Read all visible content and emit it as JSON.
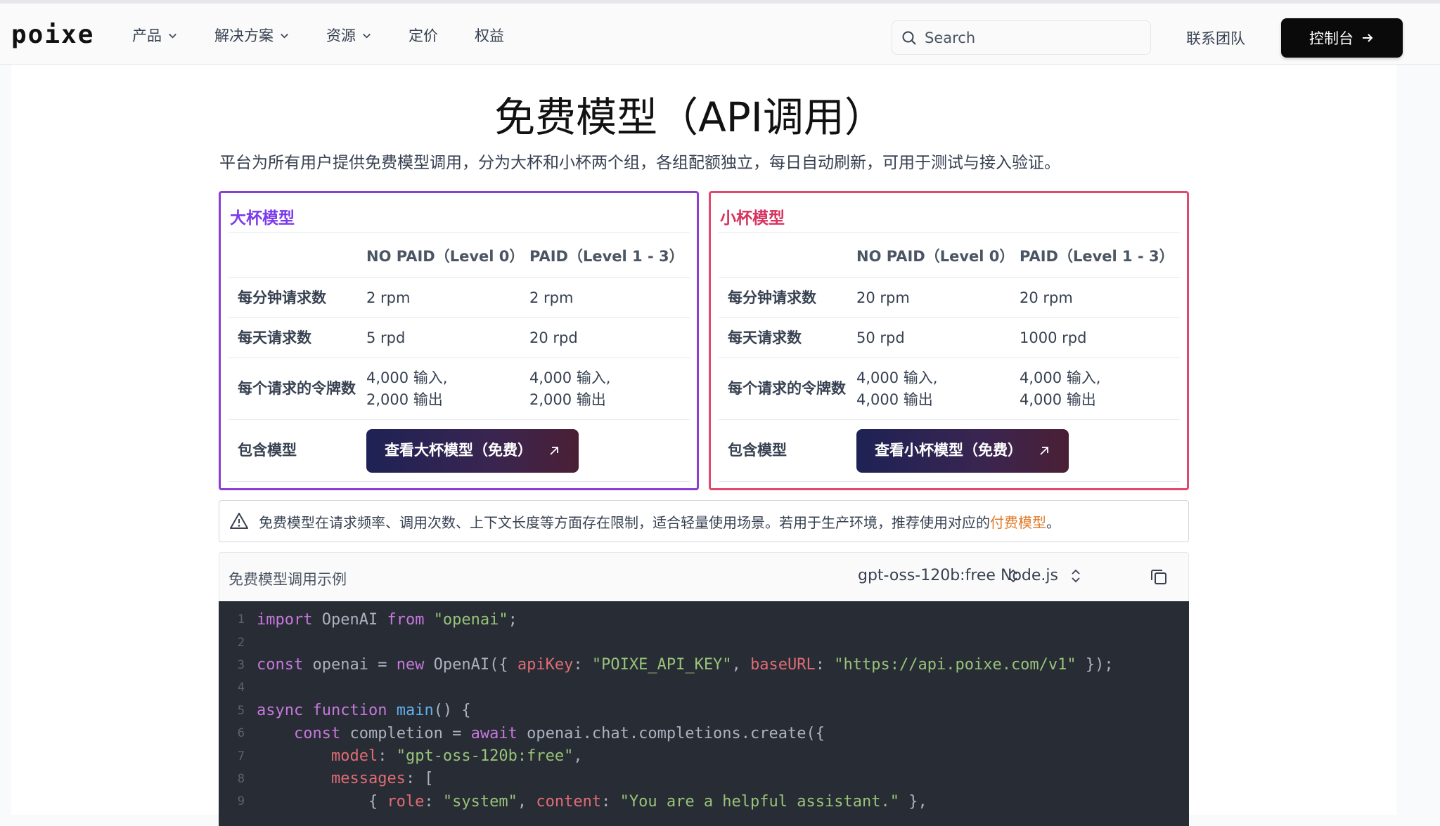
{
  "header": {
    "logo": "poixe",
    "nav": [
      {
        "label": "产品",
        "dropdown": true
      },
      {
        "label": "解决方案",
        "dropdown": true
      },
      {
        "label": "资源",
        "dropdown": true
      },
      {
        "label": "定价",
        "dropdown": false
      },
      {
        "label": "权益",
        "dropdown": false
      }
    ],
    "search_placeholder": "Search",
    "contact": "联系团队",
    "console": "控制台"
  },
  "page": {
    "title": "免费模型（API调用）",
    "subtitle": "平台为所有用户提供免费模型调用，分为大杯和小杯两个组，各组配额独立，每日自动刷新，可用于测试与接入验证。"
  },
  "cards": {
    "big": {
      "title": "大杯模型",
      "col_nopaid": "NO PAID（Level 0）",
      "col_paid": "PAID（Level 1 - 3）",
      "rows": [
        {
          "label": "每分钟请求数",
          "nopaid": "2 rpm",
          "paid": "2 rpm"
        },
        {
          "label": "每天请求数",
          "nopaid": "5 rpd",
          "paid": "20 rpd"
        },
        {
          "label": "每个请求的令牌数",
          "nopaid_a": "4,000 输入,",
          "nopaid_b": "2,000 输出",
          "paid_a": "4,000 输入,",
          "paid_b": "2,000 输出"
        }
      ],
      "models_label": "包含模型",
      "button": "查看大杯模型（免费）"
    },
    "small": {
      "title": "小杯模型",
      "col_nopaid": "NO PAID（Level 0）",
      "col_paid": "PAID（Level 1 - 3）",
      "rows": [
        {
          "label": "每分钟请求数",
          "nopaid": "20 rpm",
          "paid": "20 rpm"
        },
        {
          "label": "每天请求数",
          "nopaid": "50 rpd",
          "paid": "1000 rpd"
        },
        {
          "label": "每个请求的令牌数",
          "nopaid_a": "4,000 输入,",
          "nopaid_b": "4,000 输出",
          "paid_a": "4,000 输入,",
          "paid_b": "4,000 输出"
        }
      ],
      "models_label": "包含模型",
      "button": "查看小杯模型（免费）"
    }
  },
  "notice": {
    "text": "免费模型在请求频率、调用次数、上下文长度等方面存在限制，适合轻量使用场景。若用于生产环境，推荐使用对应的",
    "link": "付费模型",
    "end": "。"
  },
  "code_panel": {
    "title": "免费模型调用示例",
    "model_select": "gpt-oss-120b:free",
    "lang_select": "Node.js",
    "line_numbers": [
      "1",
      "2",
      "3",
      "4",
      "5",
      "6",
      "7",
      "8",
      "9"
    ]
  },
  "colors": {
    "big_accent": "#8b3fd0",
    "small_accent": "#e0486d",
    "link": "#e07b2a",
    "code_bg": "#282c34"
  },
  "icons": [
    "chevron-down-icon",
    "search-icon",
    "arrow-right-icon",
    "arrow-up-right-icon",
    "warning-icon",
    "updown-icon",
    "copy-icon"
  ]
}
